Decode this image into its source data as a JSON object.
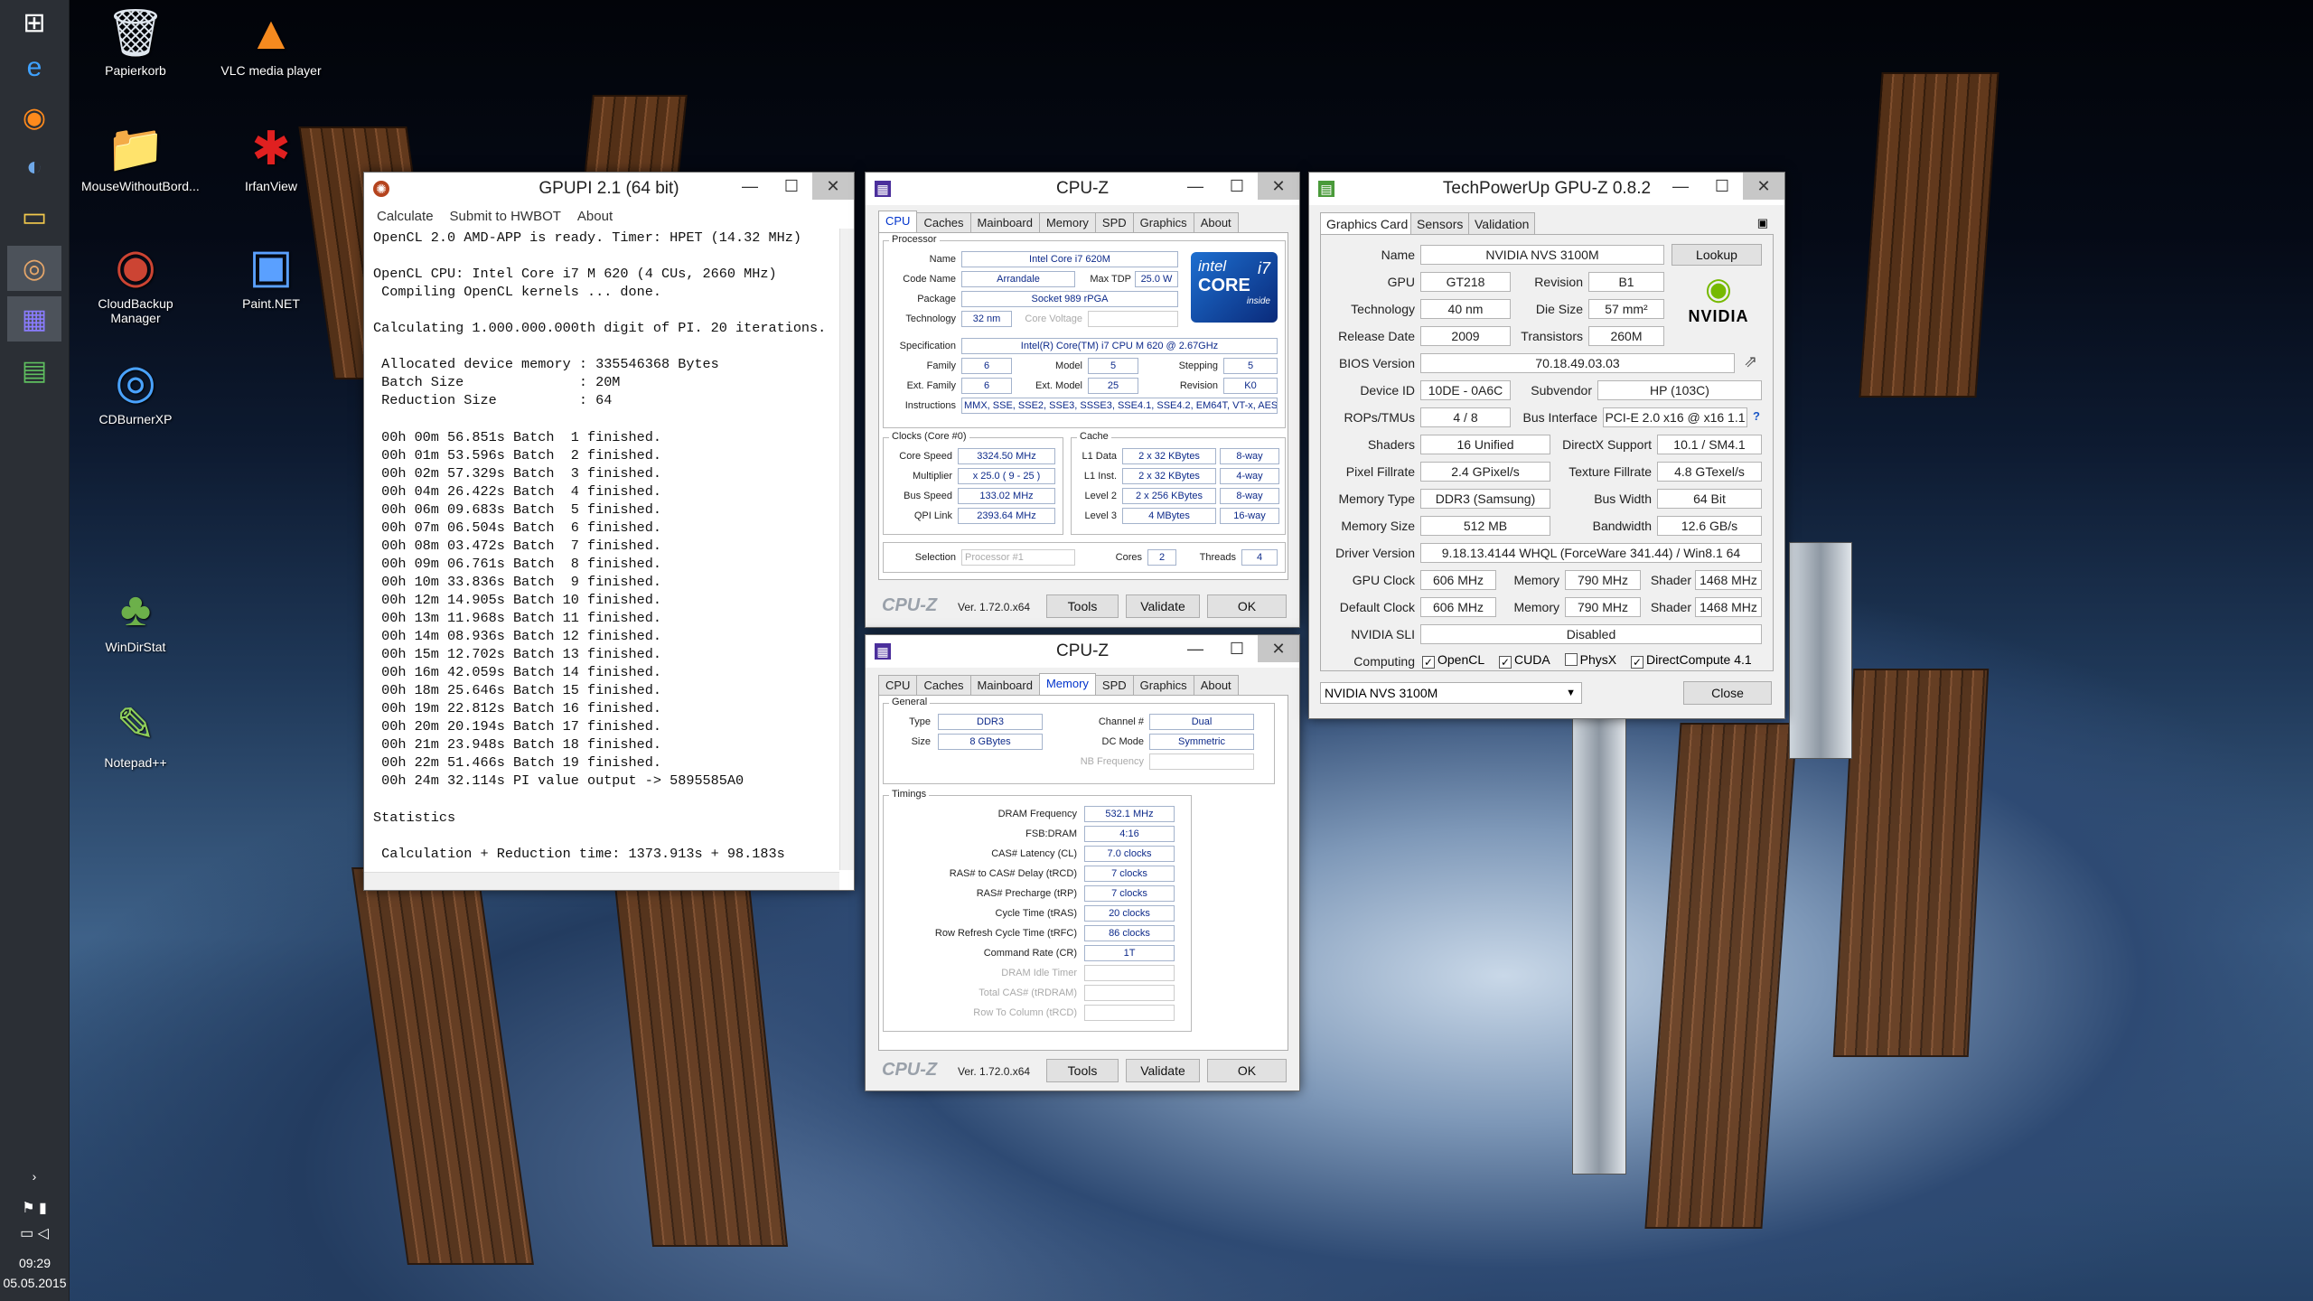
{
  "taskbar": {
    "time": "09:29",
    "date": "05.05.2015"
  },
  "desktop_icons": [
    {
      "label": "Papierkorb",
      "glyph": "🗑"
    },
    {
      "label": "VLC media player",
      "glyph": "▲"
    },
    {
      "label": "MouseWithoutBord...",
      "glyph": "📁"
    },
    {
      "label": "IrfanView",
      "glyph": "✱"
    },
    {
      "label": "CloudBackup Manager",
      "glyph": "◉"
    },
    {
      "label": "Paint.NET",
      "glyph": "▣"
    },
    {
      "label": "CDBurnerXP",
      "glyph": "◎"
    },
    {
      "label": "WinDirStat",
      "glyph": "♣"
    },
    {
      "label": "Notepad++",
      "glyph": "✎"
    }
  ],
  "gpupi": {
    "title": "GPUPI 2.1 (64 bit)",
    "menu": [
      "Calculate",
      "Submit to HWBOT",
      "About"
    ],
    "console": "OpenCL 2.0 AMD-APP is ready. Timer: HPET (14.32 MHz)\n\nOpenCL CPU: Intel Core i7 M 620 (4 CUs, 2660 MHz)\n Compiling OpenCL kernels ... done.\n\nCalculating 1.000.000.000th digit of PI. 20 iterations.\n\n Allocated device memory : 335546368 Bytes\n Batch Size              : 20M\n Reduction Size          : 64\n\n 00h 00m 56.851s Batch  1 finished.\n 00h 01m 53.596s Batch  2 finished.\n 00h 02m 57.329s Batch  3 finished.\n 00h 04m 26.422s Batch  4 finished.\n 00h 06m 09.683s Batch  5 finished.\n 00h 07m 06.504s Batch  6 finished.\n 00h 08m 03.472s Batch  7 finished.\n 00h 09m 06.761s Batch  8 finished.\n 00h 10m 33.836s Batch  9 finished.\n 00h 12m 14.905s Batch 10 finished.\n 00h 13m 11.968s Batch 11 finished.\n 00h 14m 08.936s Batch 12 finished.\n 00h 15m 12.702s Batch 13 finished.\n 00h 16m 42.059s Batch 14 finished.\n 00h 18m 25.646s Batch 15 finished.\n 00h 19m 22.812s Batch 16 finished.\n 00h 20m 20.194s Batch 17 finished.\n 00h 21m 23.948s Batch 18 finished.\n 00h 22m 51.466s Batch 19 finished.\n 00h 24m 32.114s PI value output -> 5895585A0\n\nStatistics\n\n Calculation + Reduction time: 1373.913s + 98.183s"
  },
  "cpuz_tabs": [
    "CPU",
    "Caches",
    "Mainboard",
    "Memory",
    "SPD",
    "Graphics",
    "About"
  ],
  "cpuz1": {
    "title": "CPU-Z",
    "processor_group": "Processor",
    "name_lbl": "Name",
    "name": "Intel Core i7 620M",
    "codename_lbl": "Code Name",
    "codename": "Arrandale",
    "maxtdp_lbl": "Max TDP",
    "maxtdp": "25.0 W",
    "package_lbl": "Package",
    "package": "Socket 989 rPGA",
    "tech_lbl": "Technology",
    "tech": "32 nm",
    "corevolt_lbl": "Core Voltage",
    "corevolt": "",
    "spec_lbl": "Specification",
    "spec": "Intel(R) Core(TM) i7 CPU      M 620  @ 2.67GHz",
    "family_lbl": "Family",
    "family": "6",
    "model_lbl": "Model",
    "model": "5",
    "stepping_lbl": "Stepping",
    "stepping": "5",
    "extfamily_lbl": "Ext. Family",
    "extfamily": "6",
    "extmodel_lbl": "Ext. Model",
    "extmodel": "25",
    "revision_lbl": "Revision",
    "revision": "K0",
    "instr_lbl": "Instructions",
    "instr": "MMX, SSE, SSE2, SSE3, SSSE3, SSE4.1, SSE4.2, EM64T, VT-x, AES",
    "clocks_group": "Clocks (Core #0)",
    "corespeed_lbl": "Core Speed",
    "corespeed": "3324.50 MHz",
    "mult_lbl": "Multiplier",
    "mult": "x 25.0 ( 9 - 25 )",
    "bus_lbl": "Bus Speed",
    "bus": "133.02 MHz",
    "qpi_lbl": "QPI Link",
    "qpi": "2393.64 MHz",
    "cache_group": "Cache",
    "l1d_lbl": "L1 Data",
    "l1d": "2 x 32 KBytes",
    "l1d_way": "8-way",
    "l1i_lbl": "L1 Inst.",
    "l1i": "2 x 32 KBytes",
    "l1i_way": "4-way",
    "l2_lbl": "Level 2",
    "l2": "2 x 256 KBytes",
    "l2_way": "8-way",
    "l3_lbl": "Level 3",
    "l3": "4 MBytes",
    "l3_way": "16-way",
    "sel_lbl": "Selection",
    "sel": "Processor #1",
    "cores_lbl": "Cores",
    "cores": "2",
    "threads_lbl": "Threads",
    "threads": "4",
    "intel_line1": "intel",
    "intel_line2": "CORE",
    "intel_line3": "inside",
    "intel_badge": "i7"
  },
  "cpuz2": {
    "title": "CPU-Z",
    "general_group": "General",
    "type_lbl": "Type",
    "type": "DDR3",
    "size_lbl": "Size",
    "size": "8 GBytes",
    "channel_lbl": "Channel #",
    "channel": "Dual",
    "dcmode_lbl": "DC Mode",
    "dcmode": "Symmetric",
    "nbfreq_lbl": "NB Frequency",
    "nbfreq": "",
    "timings_group": "Timings",
    "timings": [
      {
        "label": "DRAM Frequency",
        "value": "532.1 MHz",
        "gray": false
      },
      {
        "label": "FSB:DRAM",
        "value": "4:16",
        "gray": false
      },
      {
        "label": "CAS# Latency (CL)",
        "value": "7.0 clocks",
        "gray": false
      },
      {
        "label": "RAS# to CAS# Delay (tRCD)",
        "value": "7 clocks",
        "gray": false
      },
      {
        "label": "RAS# Precharge (tRP)",
        "value": "7 clocks",
        "gray": false
      },
      {
        "label": "Cycle Time (tRAS)",
        "value": "20 clocks",
        "gray": false
      },
      {
        "label": "Row Refresh Cycle Time (tRFC)",
        "value": "86 clocks",
        "gray": false
      },
      {
        "label": "Command Rate (CR)",
        "value": "1T",
        "gray": false
      },
      {
        "label": "DRAM Idle Timer",
        "value": "",
        "gray": true
      },
      {
        "label": "Total CAS# (tRDRAM)",
        "value": "",
        "gray": true
      },
      {
        "label": "Row To Column (tRCD)",
        "value": "",
        "gray": true
      }
    ]
  },
  "cpuz_footer": {
    "logo": "CPU-Z",
    "version": "Ver. 1.72.0.x64",
    "tools": "Tools",
    "validate": "Validate",
    "ok": "OK"
  },
  "gpuz": {
    "title": "TechPowerUp GPU-Z 0.8.2",
    "tabs": [
      "Graphics Card",
      "Sensors",
      "Validation"
    ],
    "name_lbl": "Name",
    "name": "NVIDIA NVS 3100M",
    "lookup": "Lookup",
    "gpu_lbl": "GPU",
    "gpu": "GT218",
    "revision_lbl": "Revision",
    "revision": "B1",
    "tech_lbl": "Technology",
    "tech": "40 nm",
    "die_lbl": "Die Size",
    "die": "57 mm²",
    "release_lbl": "Release Date",
    "release": "2009",
    "trans_lbl": "Transistors",
    "trans": "260M",
    "bios_lbl": "BIOS Version",
    "bios": "70.18.49.03.03",
    "devid_lbl": "Device ID",
    "devid": "10DE - 0A6C",
    "subv_lbl": "Subvendor",
    "subv": "HP (103C)",
    "rops_lbl": "ROPs/TMUs",
    "rops": "4 / 8",
    "busif_lbl": "Bus Interface",
    "busif": "PCI-E 2.0 x16 @ x16 1.1",
    "shaders_lbl": "Shaders",
    "shaders": "16 Unified",
    "dx_lbl": "DirectX Support",
    "dx": "10.1 / SM4.1",
    "pixel_lbl": "Pixel Fillrate",
    "pixel": "2.4 GPixel/s",
    "texture_lbl": "Texture Fillrate",
    "texture": "4.8 GTexel/s",
    "memtype_lbl": "Memory Type",
    "memtype": "DDR3 (Samsung)",
    "buswidth_lbl": "Bus Width",
    "buswidth": "64 Bit",
    "memsize_lbl": "Memory Size",
    "memsize": "512 MB",
    "bandwidth_lbl": "Bandwidth",
    "bandwidth": "12.6 GB/s",
    "driver_lbl": "Driver Version",
    "driver": "9.18.13.4144 WHQL (ForceWare 341.44) / Win8.1 64",
    "gpuclock_lbl": "GPU Clock",
    "gpuclock": "606 MHz",
    "mem_lbl": "Memory",
    "memclock": "790 MHz",
    "shader_lbl": "Shader",
    "shaderclock": "1468 MHz",
    "defclock_lbl": "Default Clock",
    "defclock": "606 MHz",
    "defmem": "790 MHz",
    "defshader": "1468 MHz",
    "sli_lbl": "NVIDIA SLI",
    "sli": "Disabled",
    "computing_lbl": "Computing",
    "computing": [
      {
        "label": "OpenCL",
        "checked": true
      },
      {
        "label": "CUDA",
        "checked": true
      },
      {
        "label": "PhysX",
        "checked": false
      },
      {
        "label": "DirectCompute 4.1",
        "checked": true
      }
    ],
    "select": "NVIDIA NVS 3100M",
    "close": "Close",
    "nvidia": "NVIDIA"
  }
}
